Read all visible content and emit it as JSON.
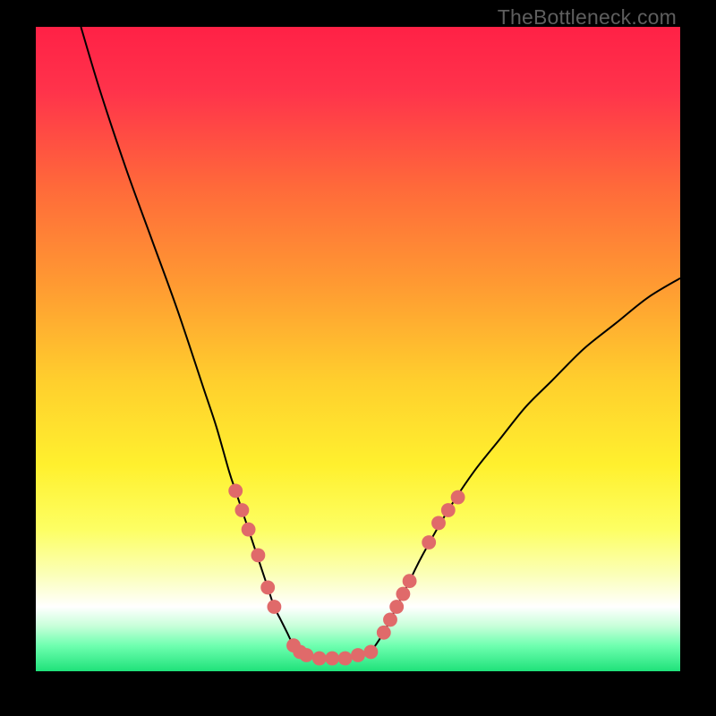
{
  "watermark": "TheBottleneck.com",
  "chart_data": {
    "type": "line",
    "title": "",
    "xlabel": "",
    "ylabel": "",
    "xlim": [
      0,
      100
    ],
    "ylim": [
      0,
      100
    ],
    "grid": false,
    "legend": false,
    "background_gradient": {
      "top": "#ff2a4d",
      "upper_mid": "#ff8a2a",
      "mid": "#ffe92a",
      "lower_mid": "#f7ff9a",
      "band": "#ffffff",
      "bottom": "#1fe27a"
    },
    "series": [
      {
        "name": "left-curve",
        "color": "#000000",
        "x": [
          7,
          10,
          14,
          18,
          22,
          26,
          28,
          30,
          31,
          32,
          33,
          34,
          35,
          36,
          37,
          38,
          39,
          40,
          41
        ],
        "y": [
          100,
          90,
          78,
          67,
          56,
          44,
          38,
          31,
          28,
          25,
          22,
          19,
          16,
          13,
          10,
          8,
          6,
          4,
          3
        ]
      },
      {
        "name": "valley-floor",
        "color": "#000000",
        "x": [
          41,
          44,
          48,
          52
        ],
        "y": [
          3,
          2,
          2,
          3
        ]
      },
      {
        "name": "right-curve",
        "color": "#000000",
        "x": [
          52,
          54,
          56,
          58,
          60,
          64,
          68,
          72,
          76,
          80,
          85,
          90,
          95,
          100
        ],
        "y": [
          3,
          6,
          10,
          14,
          18,
          25,
          31,
          36,
          41,
          45,
          50,
          54,
          58,
          61
        ]
      }
    ],
    "markers": {
      "name": "highlight-dots",
      "color": "#e06a6a",
      "radius": 1.1,
      "points": [
        {
          "x": 31,
          "y": 28
        },
        {
          "x": 32,
          "y": 25
        },
        {
          "x": 33,
          "y": 22
        },
        {
          "x": 34.5,
          "y": 18
        },
        {
          "x": 36,
          "y": 13
        },
        {
          "x": 37,
          "y": 10
        },
        {
          "x": 40,
          "y": 4
        },
        {
          "x": 41,
          "y": 3
        },
        {
          "x": 42,
          "y": 2.5
        },
        {
          "x": 44,
          "y": 2
        },
        {
          "x": 46,
          "y": 2
        },
        {
          "x": 48,
          "y": 2
        },
        {
          "x": 50,
          "y": 2.5
        },
        {
          "x": 52,
          "y": 3
        },
        {
          "x": 54,
          "y": 6
        },
        {
          "x": 55,
          "y": 8
        },
        {
          "x": 56,
          "y": 10
        },
        {
          "x": 57,
          "y": 12
        },
        {
          "x": 58,
          "y": 14
        },
        {
          "x": 61,
          "y": 20
        },
        {
          "x": 62.5,
          "y": 23
        },
        {
          "x": 64,
          "y": 25
        },
        {
          "x": 65.5,
          "y": 27
        }
      ]
    }
  }
}
